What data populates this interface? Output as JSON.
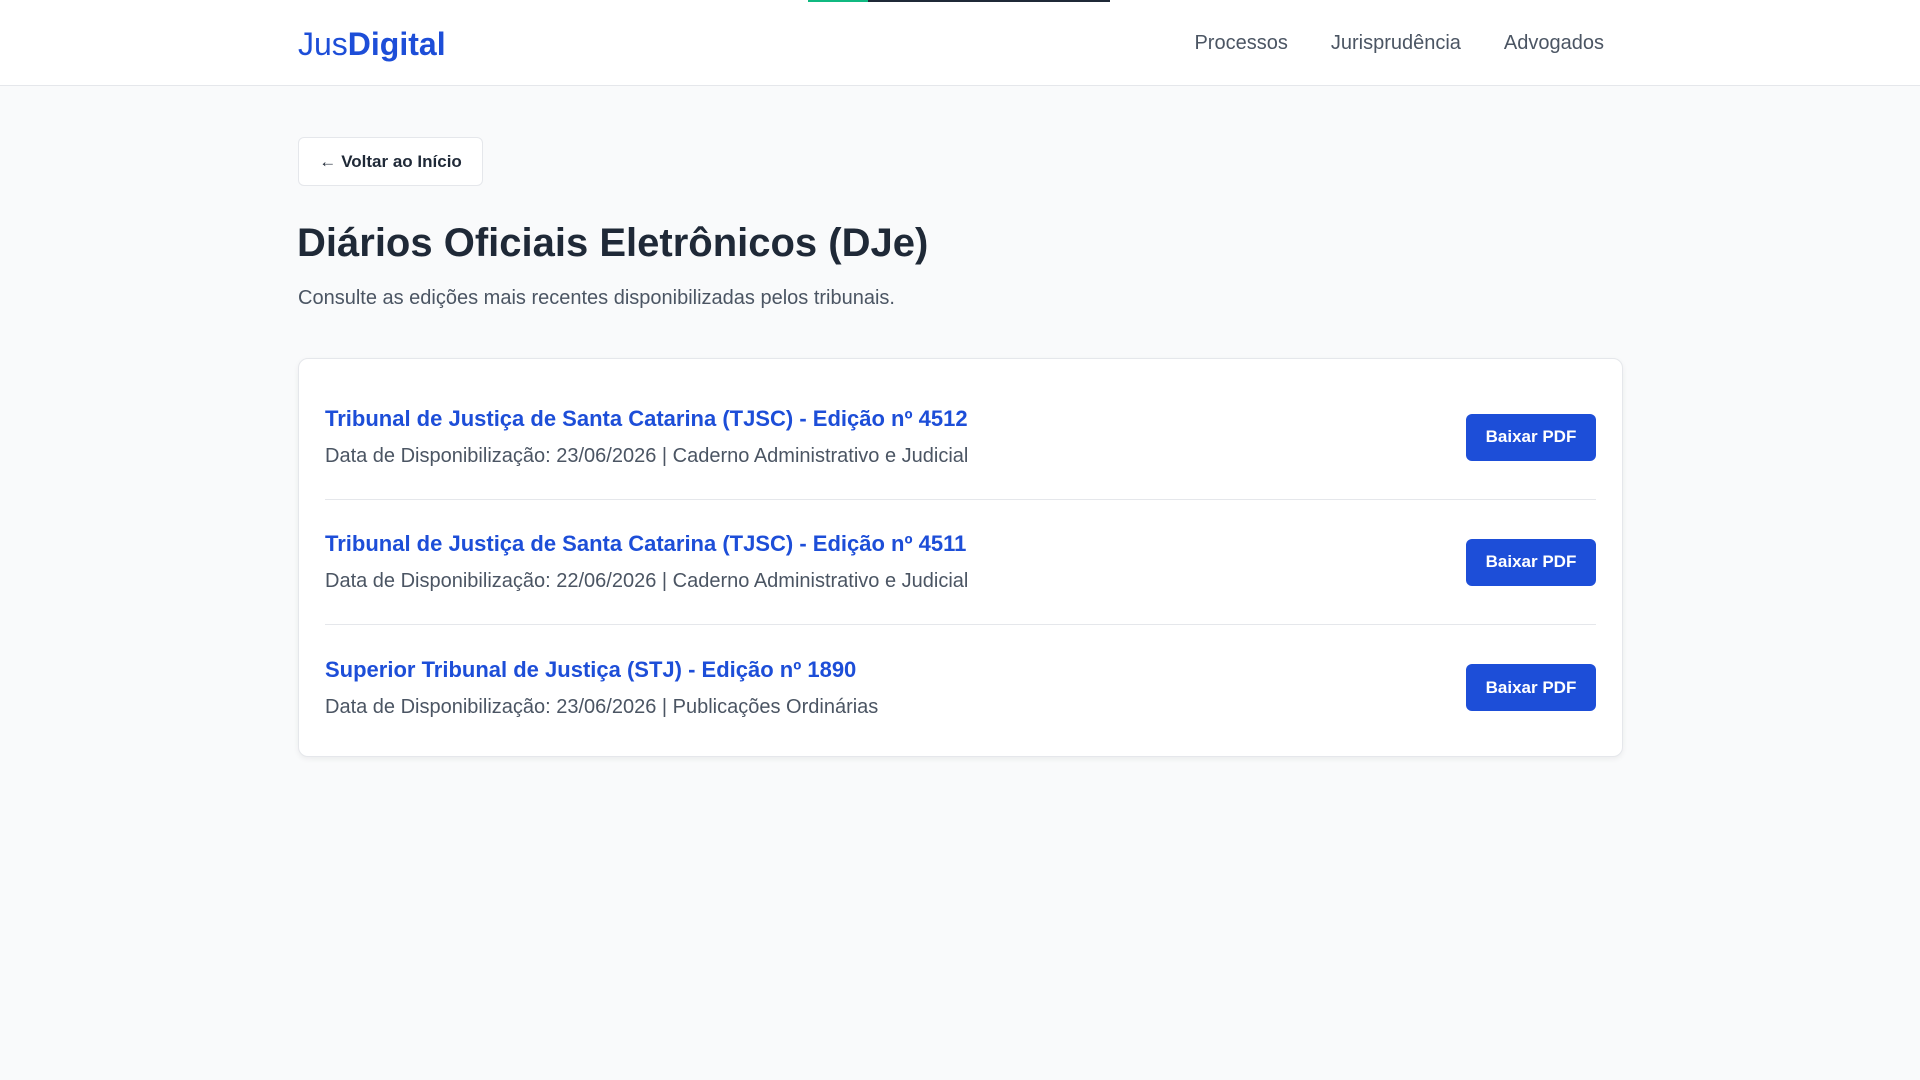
{
  "header": {
    "logo_light": "Jus",
    "logo_bold": "Digital",
    "nav": [
      "Processos",
      "Jurisprudência",
      "Advogados"
    ],
    "progress_fraction": 0.2
  },
  "back_button": {
    "arrow": "←",
    "label": "Voltar ao Início"
  },
  "page": {
    "title": "Diários Oficiais Eletrônicos (DJe)",
    "subtitle": "Consulte as edições mais recentes disponibilizadas pelos tribunais."
  },
  "editions": [
    {
      "title": "Tribunal de Justiça de Santa Catarina (TJSC) - Edição nº 4512",
      "meta": "Data de Disponibilização: 23/06/2026 | Caderno Administrativo e Judicial",
      "button": "Baixar PDF"
    },
    {
      "title": "Tribunal de Justiça de Santa Catarina (TJSC) - Edição nº 4511",
      "meta": "Data de Disponibilização: 22/06/2026 | Caderno Administrativo e Judicial",
      "button": "Baixar PDF"
    },
    {
      "title": "Superior Tribunal de Justiça (STJ) - Edição nº 1890",
      "meta": "Data de Disponibilização: 23/06/2026 | Publicações Ordinárias",
      "button": "Baixar PDF"
    }
  ],
  "colors": {
    "accent": "#1d4ed8",
    "progress": "#10b981",
    "background": "#f9fafb"
  }
}
